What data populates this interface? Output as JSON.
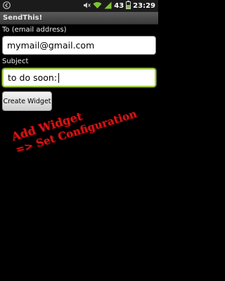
{
  "status_bar": {
    "battery_percent": "43",
    "time": "23:29",
    "icons": [
      "back-icon",
      "mute-icon",
      "wifi-icon",
      "signal-icon",
      "battery-icon"
    ]
  },
  "app": {
    "title": "SendThis!"
  },
  "form": {
    "to_label": "To (email address)",
    "to_value": "mymail@gmail.com",
    "subject_label": "Subject",
    "subject_value": "to do soon:",
    "create_button": "Create Widget"
  },
  "annotation": {
    "line1": "Add Widget",
    "line2": "=> Set Configuration",
    "color": "#d61414"
  }
}
